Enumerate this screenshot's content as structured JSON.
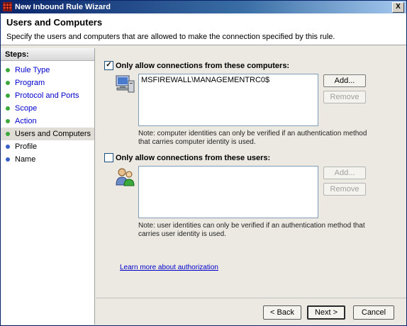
{
  "window": {
    "title": "New Inbound Rule Wizard",
    "close_glyph": "X"
  },
  "header": {
    "title": "Users and Computers",
    "description": "Specify the users and computers that are allowed to make the connection specified by this rule."
  },
  "steps": {
    "heading": "Steps:",
    "items": [
      {
        "label": "Rule Type",
        "state": "done"
      },
      {
        "label": "Program",
        "state": "done"
      },
      {
        "label": "Protocol and Ports",
        "state": "done"
      },
      {
        "label": "Scope",
        "state": "done"
      },
      {
        "label": "Action",
        "state": "done"
      },
      {
        "label": "Users and Computers",
        "state": "current"
      },
      {
        "label": "Profile",
        "state": "pending"
      },
      {
        "label": "Name",
        "state": "pending"
      }
    ]
  },
  "computers": {
    "checkbox_label": "Only allow connections from these computers:",
    "checked": true,
    "checkmark": "✓",
    "entries": [
      "MSFIREWALL\\MANAGEMENTRC0$"
    ],
    "add_label": "Add...",
    "remove_label": "Remove",
    "note": "Note: computer identities can only be verified if an authentication method that carries computer identity is used."
  },
  "users": {
    "checkbox_label": "Only allow connections from these users:",
    "checked": false,
    "add_label": "Add...",
    "remove_label": "Remove",
    "note": "Note: user identities can only be verified if an authentication method that carries user identity is used."
  },
  "learn_more": "Learn more about authorization",
  "nav": {
    "back": "< Back",
    "next": "Next >",
    "cancel": "Cancel"
  },
  "colors": {
    "done_dot": "#3aa83a",
    "pending_dot": "#3a5fc8",
    "link": "#0000cc"
  }
}
